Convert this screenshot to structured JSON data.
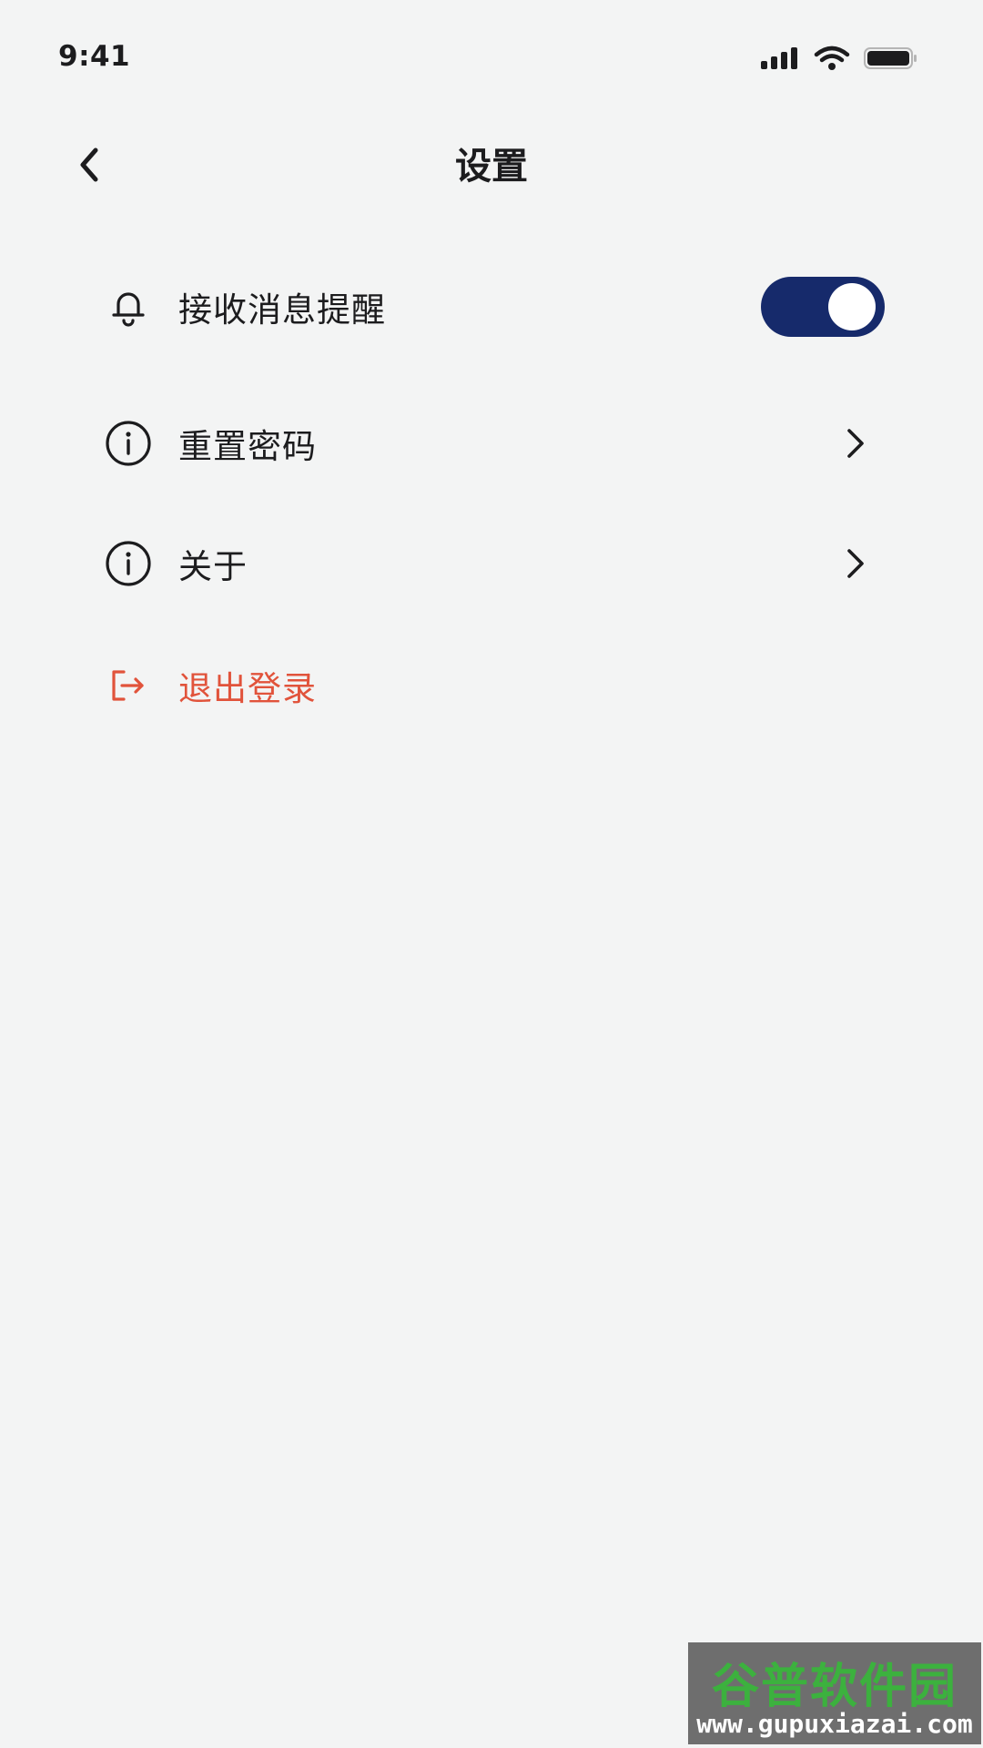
{
  "status_bar": {
    "time": "9:41"
  },
  "header": {
    "title": "设置"
  },
  "settings": {
    "notifications_label": "接收消息提醒",
    "notifications_enabled": true,
    "reset_password_label": "重置密码",
    "about_label": "关于",
    "logout_label": "退出登录"
  },
  "watermark": {
    "title": "谷普软件园",
    "url": "www.gupuxiazai.com"
  },
  "colors": {
    "toggle_on": "#162a6b",
    "logout": "#e1533b",
    "background": "#f3f4f4"
  }
}
